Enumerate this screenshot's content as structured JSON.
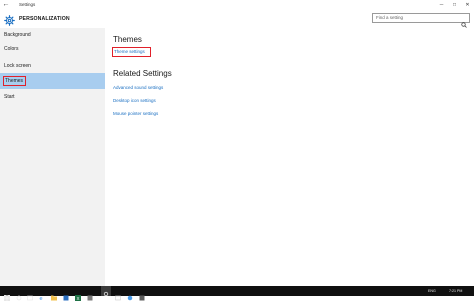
{
  "window": {
    "title": "Settings",
    "back_glyph": "←",
    "controls": {
      "minimize": "─",
      "maximize": "□",
      "close": "✕"
    }
  },
  "header": {
    "title": "PERSONALIZATION",
    "icon": "gear-icon"
  },
  "search": {
    "placeholder": "Find a setting",
    "icon": "search-icon"
  },
  "sidebar": {
    "items": [
      {
        "label": "Background",
        "selected": false
      },
      {
        "label": "Colors",
        "selected": false
      },
      {
        "label": "Lock screen",
        "selected": false
      },
      {
        "label": "Themes",
        "selected": true
      },
      {
        "label": "Start",
        "selected": false
      }
    ]
  },
  "main": {
    "themes_heading": "Themes",
    "theme_settings_link": "Theme settings",
    "related_heading": "Related Settings",
    "related_links": [
      "Advanced sound settings",
      "Desktop icon settings",
      "Mouse pointer settings"
    ]
  },
  "taskbar": {
    "icons": [
      "windows-start-icon",
      "search-icon",
      "task-view-icon",
      "edge-icon",
      "file-explorer-icon",
      "store-icon",
      "excel-icon",
      "app-icon",
      "chrome-icon",
      "settings-icon",
      "app-icon-2",
      "app-icon-3",
      "app-icon-4"
    ],
    "tray": {
      "language": "ENG",
      "time": "7:21 PM"
    }
  },
  "colors": {
    "accent": "#1a6fc2",
    "selection": "#a8cdef",
    "highlight_box": "#e0202a",
    "sidebar_bg": "#f2f2f2",
    "taskbar_bg": "#101010"
  }
}
